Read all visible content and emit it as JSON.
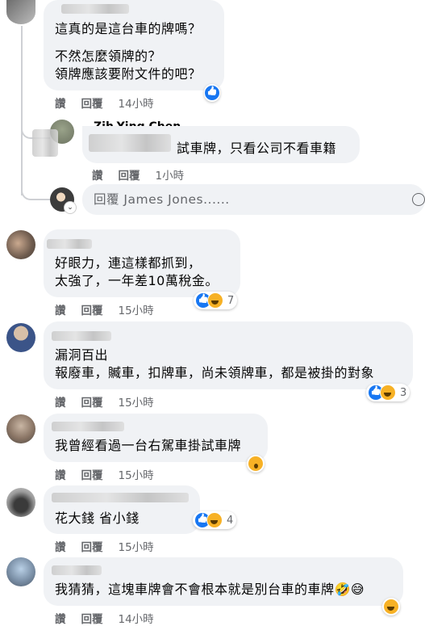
{
  "comments": [
    {
      "lines": [
        "這真的是這台車的牌嗎？",
        "不然怎麼領牌的？",
        "領牌應該要附文件的吧？"
      ],
      "time": "14小時"
    },
    {
      "lines": [
        "試車牌，只看公司不看車籍"
      ],
      "name": "Zih-Ying Chen",
      "time": "1小時"
    },
    {
      "lines": [
        "好眼力，連這樣都抓到，",
        "太強了，一年差10萬稅金。"
      ],
      "time": "15小時",
      "reaction_count": "7"
    },
    {
      "lines": [
        "漏洞百出",
        "報廢車，贓車，扣牌車，尚未領牌車，都是被掛的對象"
      ],
      "time": "15小時",
      "reaction_count": "3"
    },
    {
      "lines": [
        "我曾經看過一台右駕車掛試車牌"
      ],
      "time": "15小時"
    },
    {
      "lines": [
        "花大錢 省小錢"
      ],
      "time": "15小時",
      "reaction_count": "4"
    },
    {
      "lines": [
        "我猜猜，這塊車牌會不會根本就是別台車的車牌🤣😅"
      ],
      "time": "14小時"
    }
  ],
  "actions": {
    "like": "讚",
    "reply": "回覆"
  },
  "reply_box": {
    "placeholder": "回覆 James Jones......"
  },
  "colors": {
    "bubble": "#f0f2f5",
    "meta": "#65676b",
    "like": "#1877f2",
    "haha": "#f7b125"
  }
}
